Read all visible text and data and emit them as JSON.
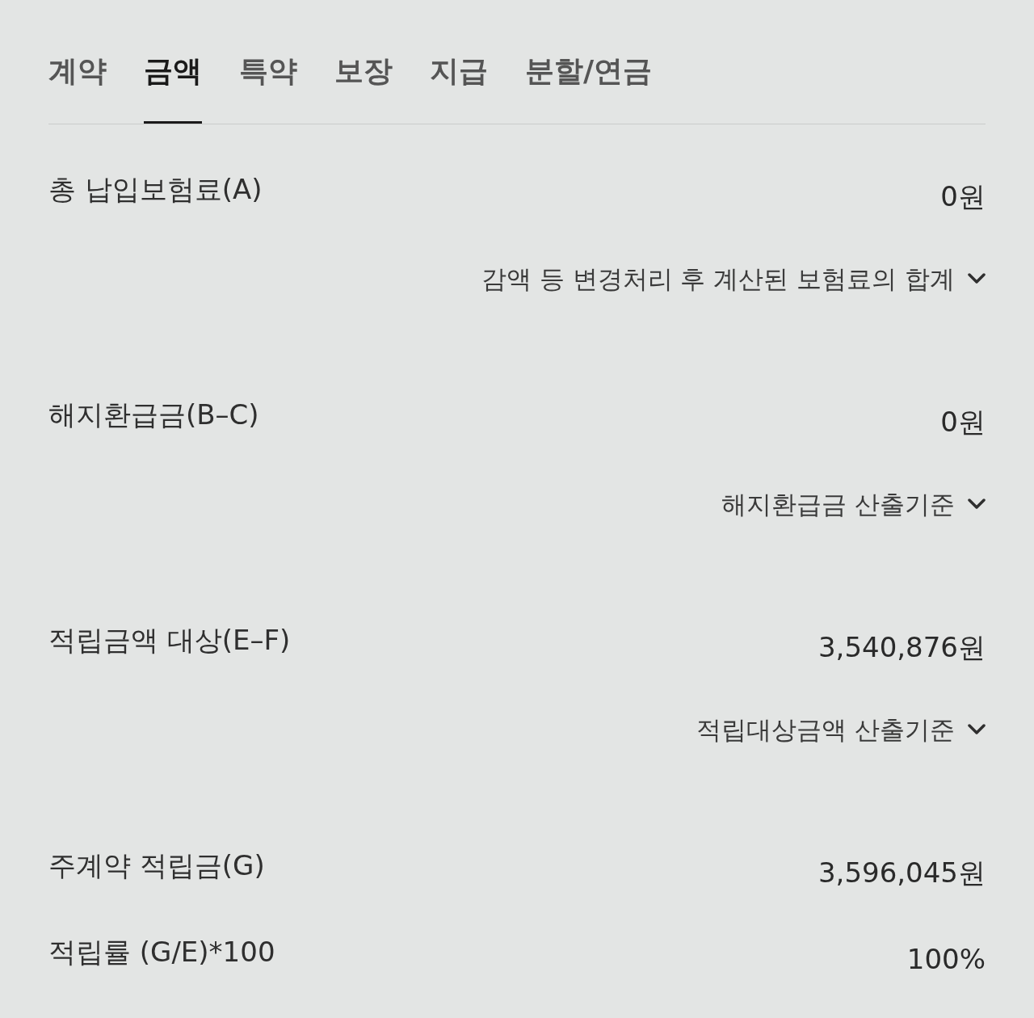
{
  "tabs": [
    {
      "label": "계약",
      "selected": false
    },
    {
      "label": "금액",
      "selected": true
    },
    {
      "label": "특약",
      "selected": false
    },
    {
      "label": "보장",
      "selected": false
    },
    {
      "label": "지급",
      "selected": false
    },
    {
      "label": "분할/연금",
      "selected": false
    }
  ],
  "items": [
    {
      "label": "총 납입보험료(A)",
      "value": "0원",
      "note": {
        "text": "감액 등 변경처리 후 계산된 보험료의 합계",
        "expanded": false
      }
    },
    {
      "label": "해지환급금(B–C)",
      "value": "0원",
      "note": {
        "text": "해지환급금 산출기준",
        "expanded": false
      }
    },
    {
      "label": "적립금액 대상(E–F)",
      "value": "3,540,876원",
      "note": {
        "text": "적립대상금액 산출기준",
        "expanded": false
      }
    },
    {
      "label": "주계약 적립금(G)",
      "value": "3,596,045원"
    },
    {
      "label": "적립률 (G/E)*100",
      "value": "100%"
    }
  ]
}
